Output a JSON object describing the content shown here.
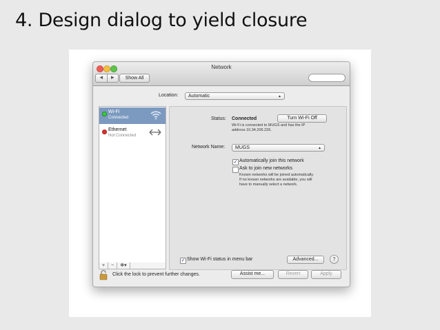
{
  "slide": {
    "title": "4. Design dialog to yield closure"
  },
  "window": {
    "title": "Network",
    "show_all": "Show All",
    "nav_back": "◀",
    "nav_forward": "▶"
  },
  "location": {
    "label": "Location:",
    "value": "Automatic"
  },
  "services": [
    {
      "name": "Wi-Fi",
      "status": "Connected",
      "status_color": "#3ad13a",
      "icon": "wifi-icon",
      "selected": true
    },
    {
      "name": "Ethernet",
      "status": "Not Connected",
      "status_color": "#e0302c",
      "icon": "ethernet-arrows-icon",
      "selected": false
    }
  ],
  "sidebar_controls": {
    "add": "+",
    "remove": "−",
    "action": "✻▾"
  },
  "detail": {
    "status_label": "Status:",
    "status_value": "Connected",
    "toggle_button": "Turn Wi-Fi Off",
    "status_desc_1": "Wi-Fi is connected to MUGS and has the IP",
    "status_desc_2": "address 10.34.206.226.",
    "network_name_label": "Network Name:",
    "network_name_value": "MUGS",
    "auto_join_label": "Automatically join this network",
    "auto_join_checked": true,
    "ask_join_label": "Ask to join new networks",
    "ask_join_checked": false,
    "ask_join_note_1": "Known networks will be joined automatically.",
    "ask_join_note_2": "If no known networks are available, you will",
    "ask_join_note_3": "have to manually select a network.",
    "show_status_label": "Show Wi-Fi status in menu bar",
    "show_status_checked": true,
    "advanced_button": "Advanced...",
    "help_button": "?"
  },
  "footer": {
    "lock_text": "Click the lock to prevent further changes.",
    "assist_button": "Assist me...",
    "revert_button": "Revert",
    "apply_button": "Apply"
  },
  "colors": {
    "selection": "#7c9ac0",
    "connected": "#3ad13a",
    "not_connected": "#e0302c"
  }
}
